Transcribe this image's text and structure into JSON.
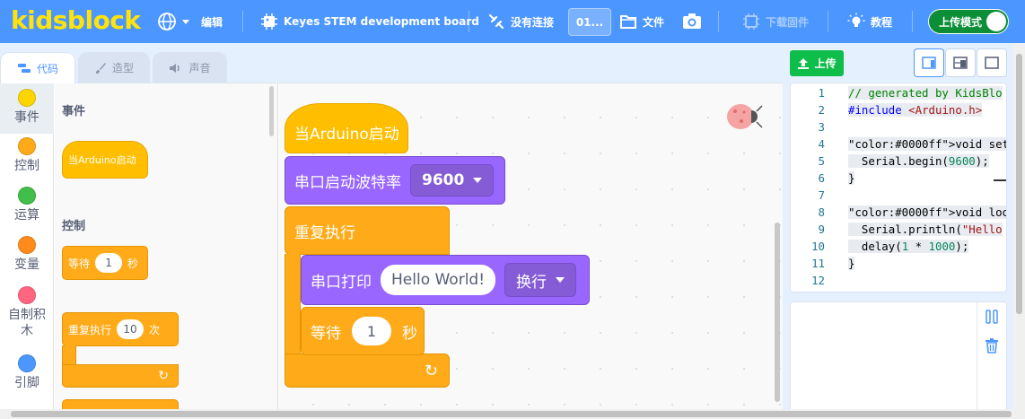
{
  "menubar": {
    "logo": "kidsblock",
    "edit": "编辑",
    "board": "Keyes STEM development board",
    "connection": "没有连接",
    "port": "01...",
    "file": "文件",
    "firmware": "下载固件",
    "tutorial": "教程",
    "mode": "上传模式"
  },
  "tabs": [
    {
      "label": "代码",
      "icon": "code-icon",
      "active": true
    },
    {
      "label": "造型",
      "icon": "brush-icon"
    },
    {
      "label": "声音",
      "icon": "speaker-icon"
    }
  ],
  "categories": [
    {
      "label": "事件",
      "color": "#ffd500"
    },
    {
      "label": "控制",
      "color": "#ffab19"
    },
    {
      "label": "运算",
      "color": "#40bf4a"
    },
    {
      "label": "变量",
      "color": "#ff8c1a"
    },
    {
      "label": "自制积木",
      "color": "#ff6680"
    },
    {
      "label": "引脚",
      "color": "#4c97ff"
    }
  ],
  "flyout": {
    "events_heading": "事件",
    "when_start": "当Arduino启动",
    "control_heading": "控制",
    "wait_label": "等待",
    "wait_value": "1",
    "wait_unit": "秒",
    "repeat_label": "重复执行",
    "repeat_value": "10",
    "repeat_unit": "次"
  },
  "workspace": {
    "hat": "当Arduino启动",
    "baud_label": "串口启动波特率",
    "baud_value": "9600",
    "forever": "重复执行",
    "print_label": "串口打印",
    "print_value": "Hello World!",
    "newline": "换行",
    "wait_label": "等待",
    "wait_value": "1",
    "wait_unit": "秒"
  },
  "right": {
    "upload": "上传",
    "code_lines": [
      {
        "n": "1",
        "text": "// generated by KidsBlo",
        "hl": true,
        "color": "#008000"
      },
      {
        "n": "2",
        "text": "#include <Arduino.h>",
        "hl": true,
        "color": "#0000ff"
      },
      {
        "n": "3",
        "text": "",
        "hl": false
      },
      {
        "n": "4",
        "text": "void setup() {",
        "hl": true
      },
      {
        "n": "5",
        "text": "  Serial.begin(9600);",
        "hl": true
      },
      {
        "n": "6",
        "text": "}",
        "hl": true
      },
      {
        "n": "7",
        "text": "",
        "hl": false
      },
      {
        "n": "8",
        "text": "void loop() {",
        "hl": true
      },
      {
        "n": "9",
        "text": "  Serial.println(\"Hello",
        "hl": true
      },
      {
        "n": "10",
        "text": "  delay(1 * 1000);",
        "hl": true
      },
      {
        "n": "11",
        "text": "}",
        "hl": true
      },
      {
        "n": "12",
        "text": "",
        "hl": false
      }
    ]
  }
}
